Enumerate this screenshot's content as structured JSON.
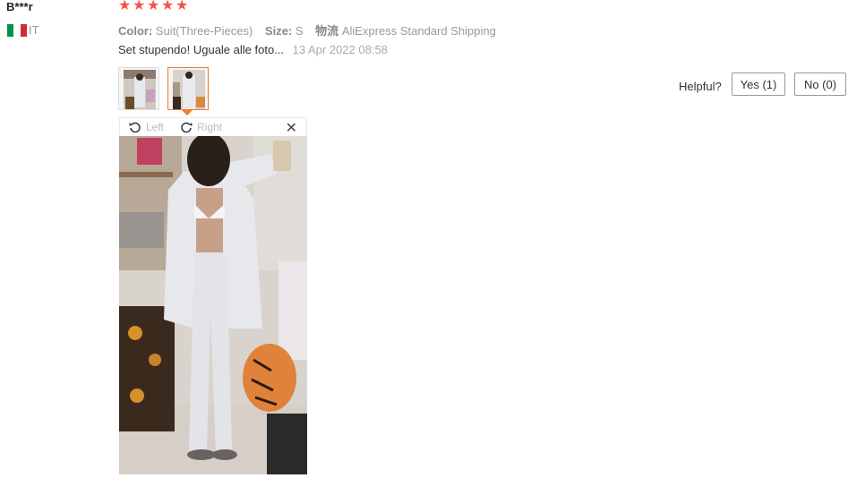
{
  "reviewer": {
    "name": "B***r",
    "country": "IT",
    "flag_colors": [
      "#009246",
      "#ffffff",
      "#ce2b37"
    ]
  },
  "rating": {
    "stars": 5,
    "max": 5,
    "star_color": "#f2544a"
  },
  "attributes": {
    "color_label": "Color:",
    "color_value": "Suit(Three-Pieces)",
    "size_label": "Size:",
    "size_value": "S",
    "shipping_label": "物流",
    "shipping_value": "AliExpress Standard Shipping"
  },
  "review": {
    "text": "Set stupendo! Uguale alle foto...",
    "date": "13 Apr 2022 08:58"
  },
  "photos": {
    "count": 2,
    "selected_index": 1,
    "accent_color": "#f07c2a"
  },
  "viewer": {
    "rotate_left_label": "Left",
    "rotate_right_label": "Right",
    "close_icon": "close-icon"
  },
  "helpful": {
    "label": "Helpful?",
    "yes_label": "Yes (1)",
    "no_label": "No (0)"
  }
}
